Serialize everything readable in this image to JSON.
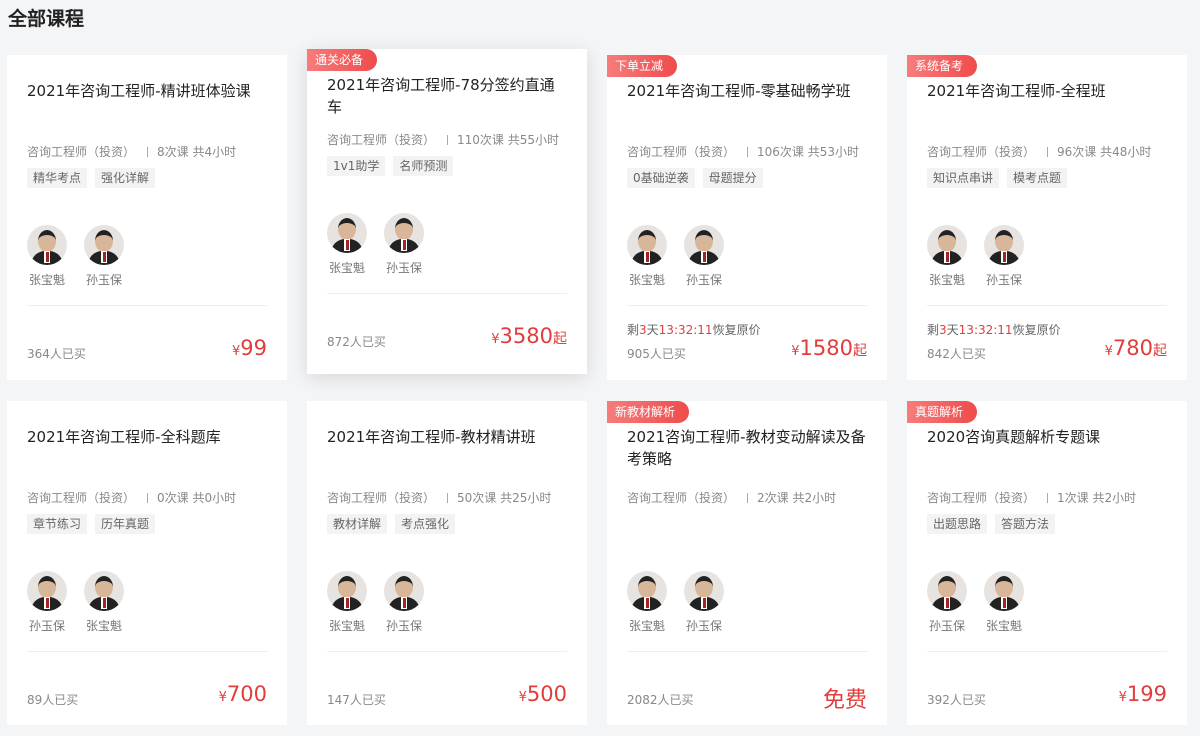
{
  "page_title": "全部课程",
  "accent_color": "#e23c3c",
  "cards": [
    {
      "badge": "",
      "title": "2021年咨询工程师-精讲班体验课",
      "category": "咨询工程师（投资）",
      "lessons": "8次课 共4小时",
      "chips": [
        "精华考点",
        "强化详解"
      ],
      "teachers": [
        "张宝魁",
        "孙玉保"
      ],
      "countdown": null,
      "buyers": "364人已买",
      "price": {
        "currency": "¥",
        "amount": "99",
        "suffix": "",
        "free": ""
      }
    },
    {
      "badge": "通关必备",
      "title": "2021年咨询工程师-78分签约直通车",
      "category": "咨询工程师（投资）",
      "lessons": "110次课 共55小时",
      "chips": [
        "1v1助学",
        "名师预测"
      ],
      "teachers": [
        "张宝魁",
        "孙玉保"
      ],
      "countdown": null,
      "buyers": "872人已买",
      "price": {
        "currency": "¥",
        "amount": "3580",
        "suffix": "起",
        "free": ""
      }
    },
    {
      "badge": "下单立减",
      "title": "2021年咨询工程师-零基础畅学班",
      "category": "咨询工程师（投资）",
      "lessons": "106次课 共53小时",
      "chips": [
        "0基础逆袭",
        "母题提分"
      ],
      "teachers": [
        "张宝魁",
        "孙玉保"
      ],
      "countdown": {
        "prefix": "剩",
        "days": "3",
        "unit": "天",
        "time": "13:32:11",
        "suffix": "恢复原价"
      },
      "buyers": "905人已买",
      "price": {
        "currency": "¥",
        "amount": "1580",
        "suffix": "起",
        "free": ""
      }
    },
    {
      "badge": "系统备考",
      "title": "2021年咨询工程师-全程班",
      "category": "咨询工程师（投资）",
      "lessons": "96次课 共48小时",
      "chips": [
        "知识点串讲",
        "模考点题"
      ],
      "teachers": [
        "张宝魁",
        "孙玉保"
      ],
      "countdown": {
        "prefix": "剩",
        "days": "3",
        "unit": "天",
        "time": "13:32:11",
        "suffix": "恢复原价"
      },
      "buyers": "842人已买",
      "price": {
        "currency": "¥",
        "amount": "780",
        "suffix": "起",
        "free": ""
      }
    },
    {
      "badge": "",
      "title": "2021年咨询工程师-全科题库",
      "category": "咨询工程师（投资）",
      "lessons": "0次课 共0小时",
      "chips": [
        "章节练习",
        "历年真题"
      ],
      "teachers": [
        "孙玉保",
        "张宝魁"
      ],
      "countdown": null,
      "buyers": "89人已买",
      "price": {
        "currency": "¥",
        "amount": "700",
        "suffix": "",
        "free": ""
      }
    },
    {
      "badge": "",
      "title": "2021年咨询工程师-教材精讲班",
      "category": "咨询工程师（投资）",
      "lessons": "50次课 共25小时",
      "chips": [
        "教材详解",
        "考点强化"
      ],
      "teachers": [
        "张宝魁",
        "孙玉保"
      ],
      "countdown": null,
      "buyers": "147人已买",
      "price": {
        "currency": "¥",
        "amount": "500",
        "suffix": "",
        "free": ""
      }
    },
    {
      "badge": "新教材解析",
      "title": "2021咨询工程师-教材变动解读及备考策略",
      "category": "咨询工程师（投资）",
      "lessons": "2次课 共2小时",
      "chips": [],
      "teachers": [
        "张宝魁",
        "孙玉保"
      ],
      "countdown": null,
      "buyers": "2082人已买",
      "price": {
        "currency": "",
        "amount": "",
        "suffix": "",
        "free": "免费"
      }
    },
    {
      "badge": "真题解析",
      "title": "2020咨询真题解析专题课",
      "category": "咨询工程师（投资）",
      "lessons": "1次课 共2小时",
      "chips": [
        "出题思路",
        "答题方法"
      ],
      "teachers": [
        "孙玉保",
        "张宝魁"
      ],
      "countdown": null,
      "buyers": "392人已买",
      "price": {
        "currency": "¥",
        "amount": "199",
        "suffix": "",
        "free": ""
      }
    }
  ]
}
